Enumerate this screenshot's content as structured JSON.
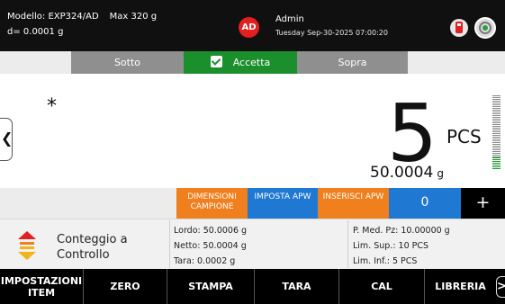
{
  "header": {
    "model": "Modello: EXP324/AD",
    "max": "Max 320 g",
    "resolution": "d= 0.0001 g",
    "avatar_initials": "AD",
    "user": "Admin",
    "datetime": "Tuesday Sep-30-2025 07:00:20",
    "icons": [
      "usb-drive-icon",
      "level-target-icon"
    ]
  },
  "tolerance": {
    "under": "Sotto",
    "accept": "Accetta",
    "over": "Sopra",
    "accept_color": "#1b8f2c"
  },
  "display": {
    "indicator": "*",
    "count": "5",
    "count_unit": "PCS",
    "net_weight": "50.0004",
    "weight_unit": "g",
    "bargraph_fraction": 0.16
  },
  "function_keys": {
    "sample_size": "DIMENSIONI CAMPIONE",
    "set_apw": "IMPOSTA APW",
    "enter_apw": "INSERISCI APW",
    "count_value": "0",
    "plus": "+"
  },
  "info": {
    "mode_label": "Conteggio a Controllo",
    "gross": "Lordo: 50.0006 g",
    "net": "Netto: 50.0004 g",
    "tare": "Tara: 0.0002 g",
    "apw": "P. Med. Pz: 10.00000 g",
    "limit_high": "Lim. Sup.: 10 PCS",
    "limit_low": "Lim. Inf.: 5 PCS"
  },
  "bottom_nav": {
    "item_settings": "IMPOSTAZIONI ITEM",
    "zero": "ZERO",
    "print": "STAMPA",
    "tare": "TARA",
    "cal": "CAL",
    "library": "LIBRERIA",
    "next": ">"
  },
  "colors": {
    "accent_orange": "#f07f1d",
    "accent_blue": "#1f78d1",
    "alert_red": "#e31f1f"
  }
}
